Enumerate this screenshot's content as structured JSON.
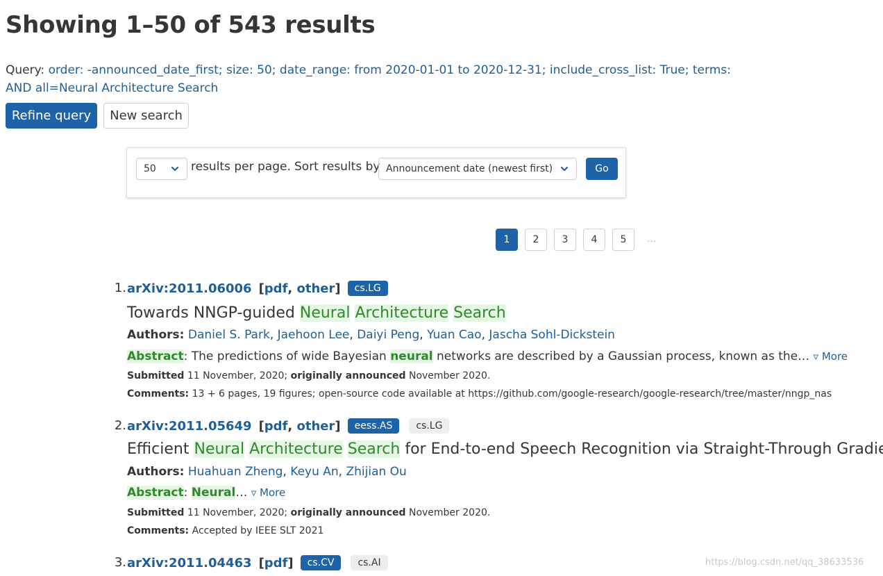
{
  "header": {
    "title": "Showing 1–50 of 543 results",
    "query_label": "Query:",
    "query_text": "order: -announced_date_first; size: 50; date_range: from 2020-01-01 to 2020-12-31; include_cross_list: True; terms: AND all=Neural Architecture Search"
  },
  "buttons": {
    "refine": "Refine query",
    "new_search": "New search"
  },
  "controls": {
    "size_value": "50",
    "results_per_page": "results per page.",
    "sort_label": "Sort results by",
    "sort_value": "Announcement date (newest first)",
    "go": "Go"
  },
  "pagination": {
    "pages": [
      "1",
      "2",
      "3",
      "4",
      "5"
    ],
    "active": "1",
    "ellipsis": "…"
  },
  "results": [
    {
      "num": "1.",
      "id": "arXiv:2011.06006",
      "links": [
        "pdf",
        "other"
      ],
      "tags": [
        {
          "label": "cs.LG",
          "primary": true
        }
      ],
      "title_pre": "Towards NNGP-guided ",
      "title_hl": [
        "Neural",
        "Architecture",
        "Search"
      ],
      "title_post": "",
      "authors_label": "Authors:",
      "authors": [
        "Daniel S. Park",
        "Jaehoon Lee",
        "Daiyi Peng",
        "Yuan Cao",
        "Jascha Sohl-Dickstein"
      ],
      "abstract_label": "Abstract",
      "abstract_pre": ": The predictions of wide Bayesian ",
      "abstract_kw": "neural",
      "abstract_post": " networks are described by a Gaussian process, known as the…",
      "more": "▿ More",
      "submitted_label": "Submitted",
      "submitted": "11 November, 2020;",
      "announced_label": "originally announced",
      "announced": "November 2020.",
      "comments_label": "Comments:",
      "comments": "13 + 6 pages, 19 figures; open-source code available at https://github.com/google-research/google-research/tree/master/nngp_nas"
    },
    {
      "num": "2.",
      "id": "arXiv:2011.05649",
      "links": [
        "pdf",
        "other"
      ],
      "tags": [
        {
          "label": "eess.AS",
          "primary": true
        },
        {
          "label": "cs.LG",
          "primary": false
        }
      ],
      "title_pre": "Efficient ",
      "title_hl": [
        "Neural",
        "Architecture",
        "Search"
      ],
      "title_post": " for End-to-end Speech Recognition via Straight-Through Gradients",
      "authors_label": "Authors:",
      "authors": [
        "Huahuan Zheng",
        "Keyu An",
        "Zhijian Ou"
      ],
      "abstract_label": "Abstract",
      "abstract_pre": ": ",
      "abstract_kw": "Neural",
      "abstract_post": "…",
      "more": "▿ More",
      "submitted_label": "Submitted",
      "submitted": "11 November, 2020;",
      "announced_label": "originally announced",
      "announced": "November 2020.",
      "comments_label": "Comments:",
      "comments": "Accepted by IEEE SLT 2021"
    },
    {
      "num": "3.",
      "id": "arXiv:2011.04463",
      "links": [
        "pdf"
      ],
      "tags": [
        {
          "label": "cs.CV",
          "primary": true
        },
        {
          "label": "cs.AI",
          "primary": false
        }
      ]
    }
  ],
  "watermark": "https://blog.csdn.net/qq_38633536",
  "colors": {
    "link": "#1f5e96",
    "primary": "#1e62a8",
    "highlight_bg": "#e5f6e4",
    "highlight_fg": "#2e8a2a"
  }
}
